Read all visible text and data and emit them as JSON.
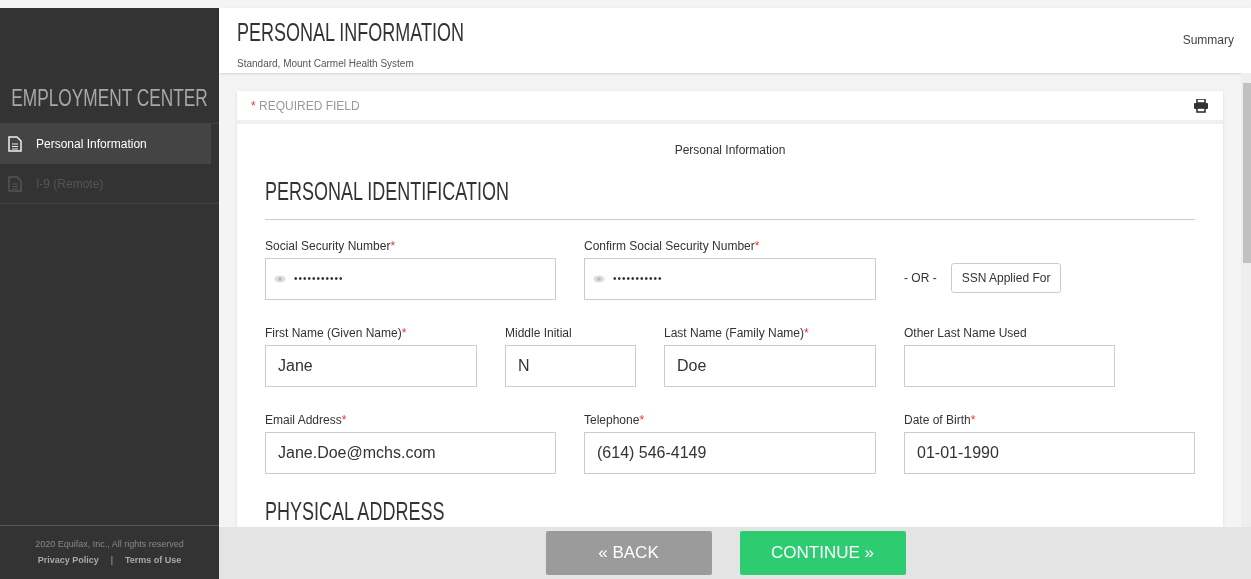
{
  "sidebar": {
    "title": "EMPLOYMENT CENTER",
    "items": [
      {
        "label": "Personal Information",
        "selected": true,
        "disabled": false
      },
      {
        "label": "I-9 (Remote)",
        "selected": false,
        "disabled": true
      }
    ],
    "copyright": "2020 Equifax, Inc., All rights reserved",
    "links": [
      "Privacy Policy",
      "Terms of Use"
    ],
    "link_separator": "|"
  },
  "header": {
    "title": "PERSONAL INFORMATION",
    "subtitle": "Standard, Mount Carmel Health System",
    "summary_link": "Summary"
  },
  "form": {
    "required_mark": "*",
    "required_note": "REQUIRED FIELD",
    "form_title": "Personal Information",
    "section": "PERSONAL IDENTIFICATION",
    "rows": [
      [
        {
          "label": "Social Security Number",
          "required": true,
          "kind": "masked",
          "value": "•••••••••••"
        },
        {
          "label": "Confirm Social Security Number",
          "required": true,
          "kind": "masked",
          "value": "•••••••••••"
        },
        {
          "kind": "alternative",
          "text": "- OR -",
          "button": "SSN Applied For"
        }
      ],
      [
        {
          "label": "First Name (Given Name)",
          "required": true,
          "kind": "text",
          "value": "Jane"
        },
        {
          "label": "Middle Initial",
          "required": false,
          "kind": "text",
          "value": "N"
        },
        {
          "label": "Last Name (Family Name)",
          "required": true,
          "kind": "text",
          "value": "Doe"
        },
        {
          "label": "Other Last Name Used",
          "required": false,
          "kind": "text"
        }
      ],
      [
        {
          "label": "Email Address",
          "required": true,
          "kind": "text",
          "value": "Jane.Doe@mchs.com"
        },
        {
          "label": "Telephone",
          "required": true,
          "kind": "text",
          "value": "(614) 546-4149"
        },
        {
          "label": "Date of Birth",
          "required": true,
          "kind": "text",
          "value": "01-01-1990"
        }
      ]
    ],
    "next_section": "PHYSICAL ADDRESS"
  },
  "footer": {
    "back": "BACK",
    "continue": "CONTINUE",
    "back_glyph": "«",
    "continue_glyph": "»"
  }
}
